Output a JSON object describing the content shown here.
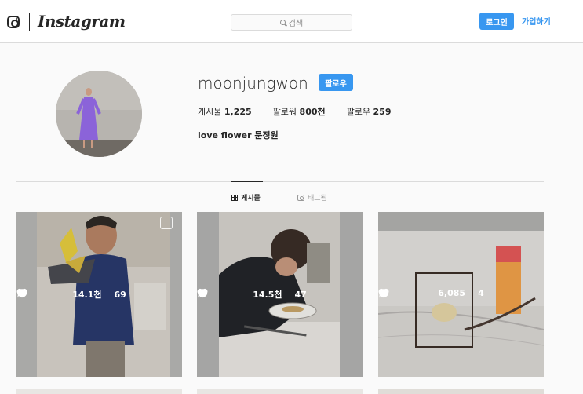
{
  "header": {
    "wordmark": "Instagram",
    "search_placeholder": "검색",
    "login_label": "로그인",
    "signup_label": "가입하기"
  },
  "profile": {
    "username": "moonjungwon",
    "follow_label": "팔로우",
    "stats": [
      {
        "label": "게시물",
        "value": "1,225"
      },
      {
        "label": "팔로워",
        "value": "800천"
      },
      {
        "label": "팔로우",
        "value": "259"
      }
    ],
    "bio": "love flower 문정원"
  },
  "tabs": [
    {
      "label": "게시물",
      "active": true,
      "icon": "grid-icon"
    },
    {
      "label": "태그됨",
      "active": false,
      "icon": "tag-icon"
    }
  ],
  "posts": [
    {
      "likes": "14.1천",
      "comments": "69",
      "multi": true
    },
    {
      "likes": "14.5천",
      "comments": "47",
      "multi": false
    },
    {
      "likes": "6,085",
      "comments": "4",
      "multi": false
    }
  ],
  "colors": {
    "accent": "#3897f0",
    "text": "#262626",
    "border": "#dbdbdb",
    "background": "#fafafa"
  }
}
